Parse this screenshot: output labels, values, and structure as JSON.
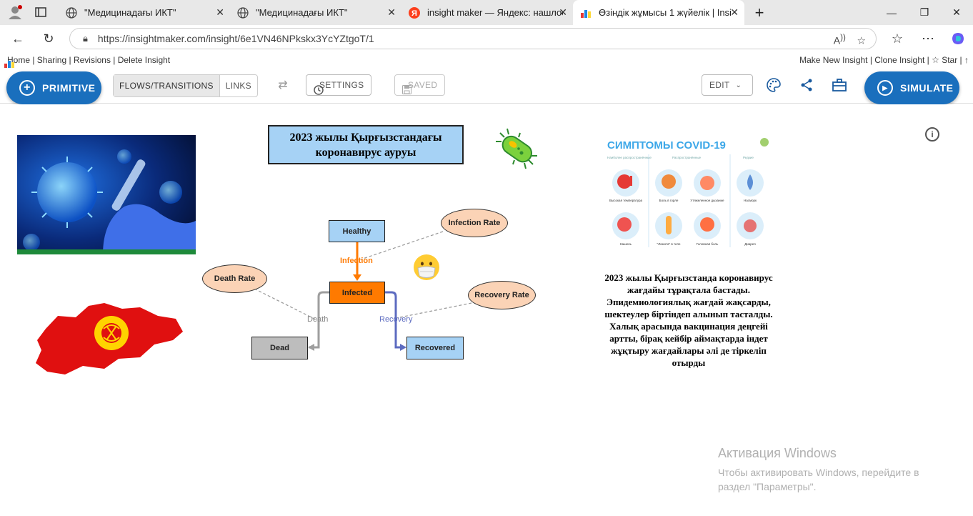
{
  "browser": {
    "tabs": [
      {
        "label": "\"Медицинадағы ИКТ\"",
        "icon": "globe-icon"
      },
      {
        "label": "\"Медицинадағы ИКТ\"",
        "icon": "globe-icon"
      },
      {
        "label": "insight maker — Яндекс: нашлос",
        "icon": "yandex-icon"
      },
      {
        "label": "Өзіндік жұмысы 1 жүйелік | Insi",
        "icon": "insightmaker-icon"
      }
    ],
    "url": "https://insightmaker.com/insight/6e1VN46NPkskx3YcYZtgoT/1"
  },
  "topnav": {
    "left": "Home | Sharing | Revisions | Delete Insight",
    "right": "Make New Insight | Clone Insight | ☆ Star | ↑"
  },
  "toolbar": {
    "primitive": "PRIMITIVE",
    "flows": "FLOWS/TRANSITIONS",
    "links": "LINKS",
    "settings": "SETTINGS",
    "saved": "SAVED",
    "edit": "EDIT",
    "simulate": "SIMULATE"
  },
  "diagram": {
    "title": "2023 жылы Қырғызстандағы коронавирус ауруы",
    "stocks": {
      "healthy": "Healthy",
      "infected": "Infected",
      "dead": "Dead",
      "recovered": "Recovered"
    },
    "variables": {
      "infection_rate": "Infection Rate",
      "death_rate": "Death Rate",
      "recovery_rate": "Recovery Rate"
    },
    "flows": {
      "infection": "Infection",
      "death": "Death",
      "recovery": "Recovery"
    },
    "description": "2023 жылы Қырғызстанда коронавирус жағдайы тұрақтала бастады. Эпидемиологиялық жағдай жақсарды, шектеулер біртіндеп алынып тасталды. Халық арасында вакцинация деңгейі артты, бірақ кейбір аймақтарда індет жұқтыру жағдайлары әлі де тіркеліп отырды",
    "colors": {
      "stock": "#a6d2f5",
      "infected": "#ff7a00",
      "dead": "#bdbdbd",
      "variable": "#fbd3b6"
    }
  },
  "symptoms_image": {
    "title": "СИМПТОМЫ COVID-19",
    "groups": [
      "Наиболее распространённые",
      "Распространённые",
      "Редкие"
    ],
    "items": [
      "Высокая температура",
      "Боль в горле",
      "Утяжеленное дыхание",
      "Насморк",
      "Кашель",
      "\"Ломота\" в теле",
      "Головная боль",
      "Диарея"
    ]
  },
  "watermark": {
    "title": "Активация Windows",
    "text": "Чтобы активировать Windows, перейдите в раздел \"Параметры\"."
  }
}
